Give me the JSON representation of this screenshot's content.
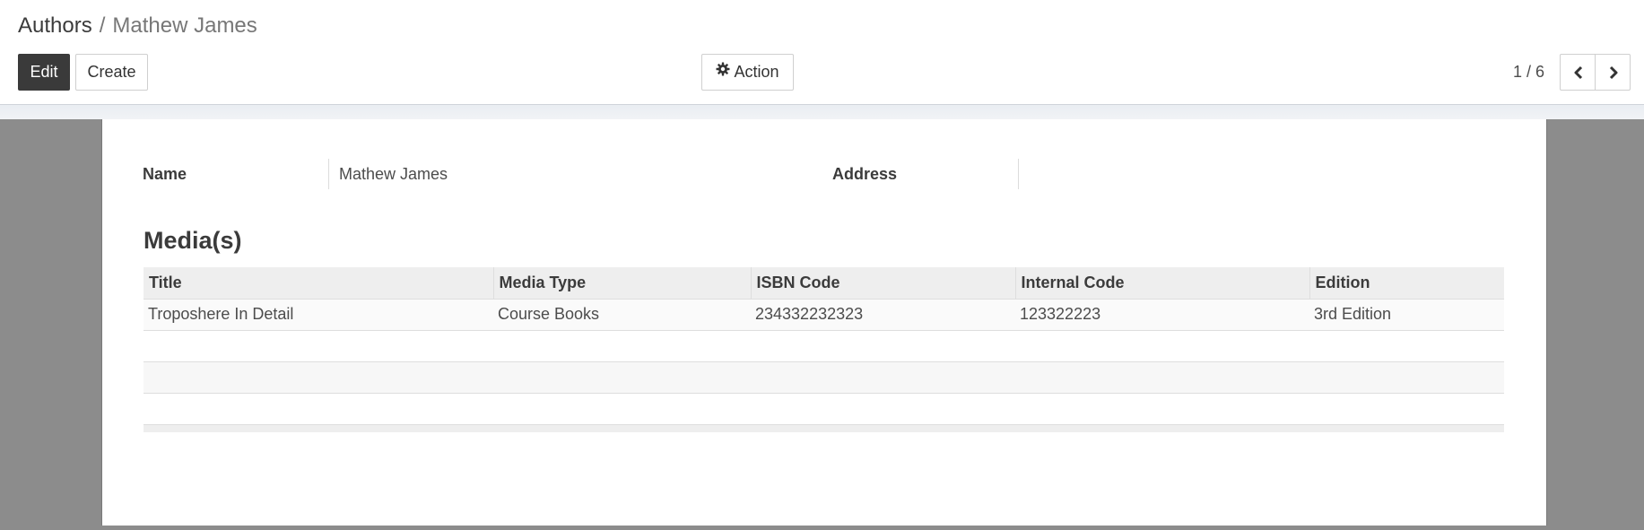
{
  "breadcrumb": {
    "parent": "Authors",
    "separator": "/",
    "current": "Mathew James"
  },
  "buttons": {
    "edit": "Edit",
    "create": "Create",
    "action": "Action",
    "action_icon": "gear-icon"
  },
  "pager": {
    "value": "1 / 6",
    "prev_icon": "chevron-left-icon",
    "next_icon": "chevron-right-icon"
  },
  "form": {
    "name_label": "Name",
    "name_value": "Mathew James",
    "address_label": "Address",
    "address_value": ""
  },
  "media": {
    "title": "Media(s)",
    "columns": [
      "Title",
      "Media Type",
      "ISBN Code",
      "Internal Code",
      "Edition"
    ],
    "rows": [
      [
        "Troposhere In Detail",
        "Course Books",
        "234332232323",
        "123322223",
        "3rd Edition"
      ]
    ]
  },
  "colors": {
    "primary_button": "#3a3a3a",
    "backdrop": "#8c8c8c",
    "header_row": "#eeeeee"
  }
}
